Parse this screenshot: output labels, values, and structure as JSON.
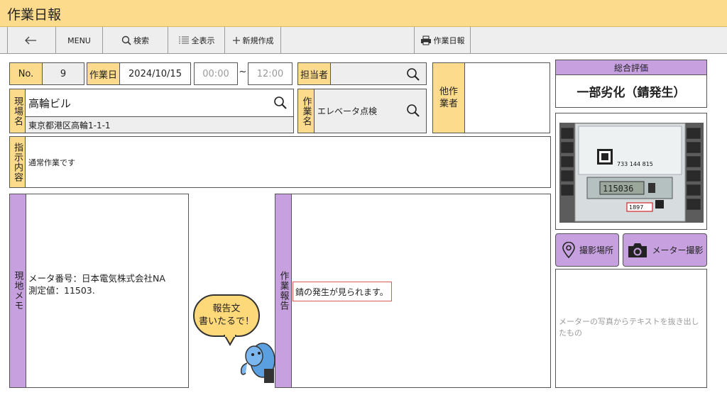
{
  "app": {
    "title": "作業日報"
  },
  "toolbar": {
    "back_label": "←",
    "menu_label": "MENU",
    "search_label": "検索",
    "show_all_label": "全表示",
    "new_label": "新規作成",
    "print_label": "作業日報"
  },
  "form": {
    "no_label": "No.",
    "no_value": "9",
    "date_label": "作業日",
    "date_value": "2024/10/15",
    "start_time": "00:00",
    "tilde": "~",
    "end_time": "12:00",
    "assignee_label": "担当者",
    "assignee_value": "",
    "other_workers_label": "他作業者",
    "site_label": "現場名",
    "site_name": "高輪ビル",
    "site_address": "東京都港区高輪1-1-1",
    "work_name_label": "作業名",
    "work_name_value": "エレベータ点検",
    "instructions_label": "指示内容",
    "instructions_value": "通常作業です",
    "memo_label": "現地メモ",
    "memo_line1": "メータ番号：日本電気株式会社NA",
    "memo_line2": "測定値：11503.",
    "report_label": "作業報告",
    "report_value": "錆の発生が見られます。"
  },
  "right": {
    "evaluation_label": "総合評価",
    "evaluation_value": "一部劣化（錆発生）",
    "location_button": "撮影場所",
    "meter_button": "メーター撮影",
    "extract_placeholder": "メーターの写真からテキストを抜き出したもの"
  },
  "photo": {
    "label_line1": "733 144 815",
    "display_value": "115036",
    "serial": "1897"
  },
  "mascot": {
    "bubble_line1": "報告文",
    "bubble_line2": "書いたるで！"
  },
  "colors": {
    "header_yellow": "#fddb8c",
    "section_purple": "#c7a0e0",
    "highlight_red": "#e05a5a"
  }
}
